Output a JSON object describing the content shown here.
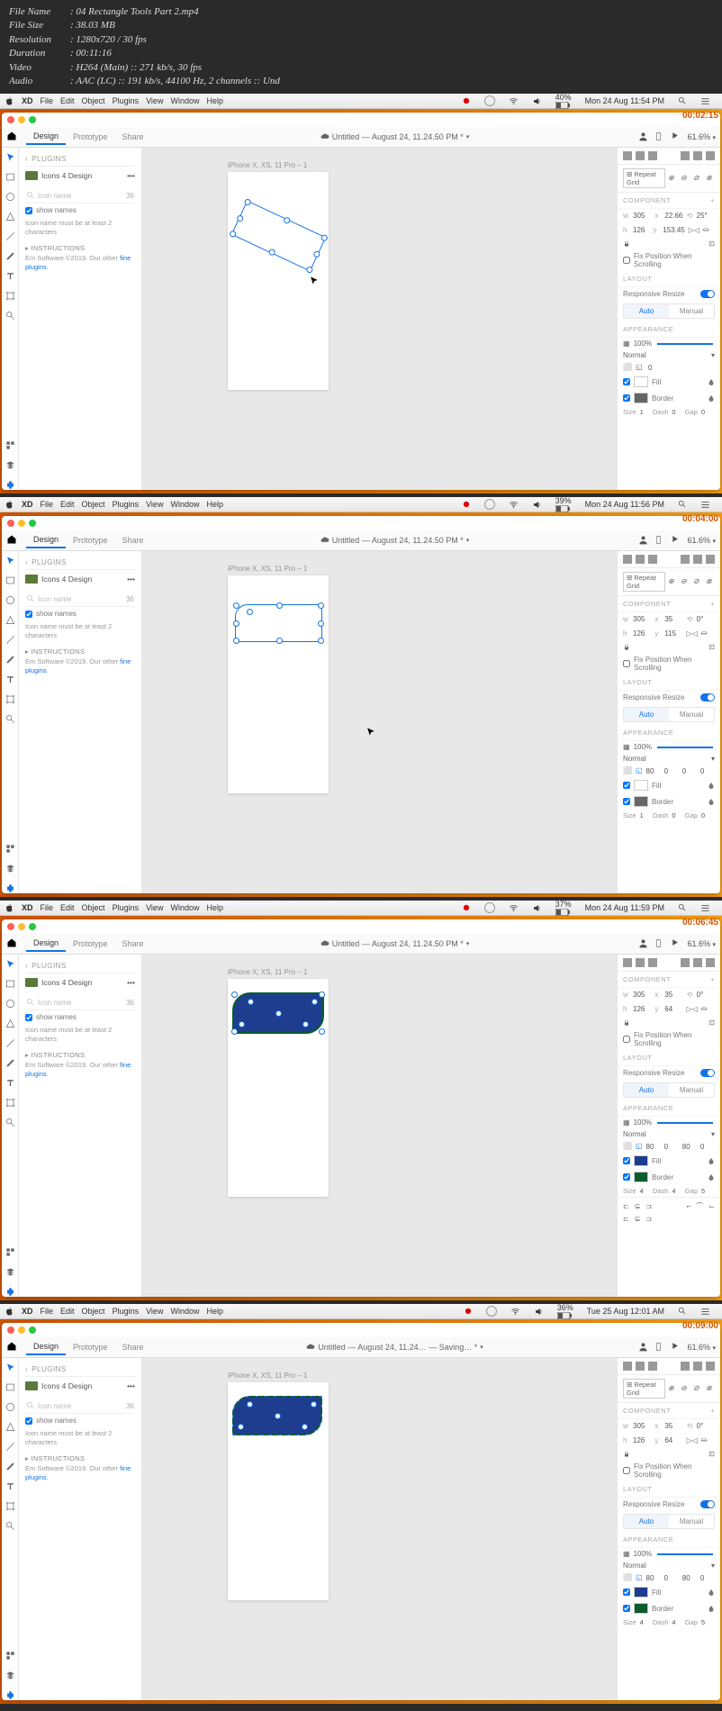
{
  "file_info": {
    "name": "04 Rectangle Tools Part 2.mp4",
    "size": "38.03 MB",
    "resolution": "1280x720 / 30 fps",
    "duration": "00:11:16",
    "video": "H264 (Main) :: 271 kb/s, 30 fps",
    "audio": "AAC (LC) :: 191 kb/s, 44100 Hz, 2 channels :: Und"
  },
  "menu": {
    "xd": "XD",
    "file": "File",
    "edit": "Edit",
    "object": "Object",
    "plugins": "Plugins",
    "view": "View",
    "window": "Window",
    "help": "Help"
  },
  "shots": [
    {
      "timestamp": "00:02:15",
      "menubar_time": "Mon 24 Aug 11:54 PM",
      "battery": "40%",
      "doc_title": "Untitled — August 24, 11.24.50 PM *",
      "zoom": "61.6%",
      "tabs": {
        "design": "Design",
        "prototype": "Prototype",
        "share": "Share"
      },
      "plugins_header": "PLUGINS",
      "plugin_name": "Icons 4 Design",
      "search_placeholder": "Icon name",
      "search_count": "36",
      "show_names": "show names",
      "note": "Icon name must be at least 2 characters",
      "instructions": "INSTRUCTIONS",
      "inst_text": "Em Software ©2019. Our other ",
      "inst_link": "fine plugins",
      "artboard": "iPhone X, XS, 11 Pro – 1",
      "props": {
        "w": "305",
        "x": "22.66",
        "rot": "25°",
        "h": "126",
        "y": "153.45",
        "flip": "⇌",
        "repeat": "Repeat Grid",
        "fix": "Fix Position When Scrolling",
        "layout": "LAYOUT",
        "resp": "Responsive Resize",
        "auto": "Auto",
        "manual": "Manual",
        "appear": "APPEARANCE",
        "opacity": "100%",
        "blend": "Normal",
        "corner": "0",
        "fill": "Fill",
        "border": "Border",
        "size": "Size",
        "size_v": "1",
        "dash": "Dash",
        "dash_v": "0",
        "gap": "Gap",
        "gap_v": "0",
        "component": "COMPONENT"
      }
    },
    {
      "timestamp": "00:04:00",
      "menubar_time": "Mon 24 Aug 11:56 PM",
      "battery": "39%",
      "doc_title": "Untitled — August 24, 11.24.50 PM *",
      "zoom": "61.6%",
      "tabs": {
        "design": "Design",
        "prototype": "Prototype",
        "share": "Share"
      },
      "plugins_header": "PLUGINS",
      "plugin_name": "Icons 4 Design",
      "search_placeholder": "Icon name",
      "search_count": "36",
      "show_names": "show names",
      "note": "Icon name must be at least 2 characters",
      "instructions": "INSTRUCTIONS",
      "inst_text": "Em Software ©2019. Our other ",
      "inst_link": "fine plugins",
      "artboard": "iPhone X, XS, 11 Pro – 1",
      "props": {
        "w": "305",
        "x": "35",
        "rot": "0°",
        "h": "126",
        "y": "115",
        "flip": "⇌",
        "repeat": "Repeat Grid",
        "fix": "Fix Position When Scrolling",
        "layout": "LAYOUT",
        "resp": "Responsive Resize",
        "auto": "Auto",
        "manual": "Manual",
        "appear": "APPEARANCE",
        "opacity": "100%",
        "blend": "Normal",
        "corner1": "80",
        "corner2": "0",
        "corner3": "0",
        "corner4": "0",
        "fill": "Fill",
        "border": "Border",
        "size": "Size",
        "size_v": "1",
        "dash": "Dash",
        "dash_v": "0",
        "gap": "Gap",
        "gap_v": "0",
        "component": "COMPONENT"
      }
    },
    {
      "timestamp": "00:06:45",
      "menubar_time": "Mon 24 Aug 11:59 PM",
      "battery": "37%",
      "doc_title": "Untitled — August 24, 11.24.50 PM *",
      "zoom": "61.6%",
      "tabs": {
        "design": "Design",
        "prototype": "Prototype",
        "share": "Share"
      },
      "plugins_header": "PLUGINS",
      "plugin_name": "Icons 4 Design",
      "search_placeholder": "Icon name",
      "search_count": "36",
      "show_names": "show names",
      "note": "Icon name must be at least 2 characters",
      "instructions": "INSTRUCTIONS",
      "inst_text": "Em Software ©2019. Our other ",
      "inst_link": "fine plugins",
      "artboard": "iPhone X, XS, 11 Pro – 1",
      "props": {
        "w": "305",
        "x": "35",
        "rot": "0°",
        "h": "126",
        "y": "64",
        "flip": "⇌",
        "fix": "Fix Position When Scrolling",
        "layout": "LAYOUT",
        "resp": "Responsive Resize",
        "auto": "Auto",
        "manual": "Manual",
        "appear": "APPEARANCE",
        "opacity": "100%",
        "blend": "Normal",
        "corner1": "80",
        "corner2": "0",
        "corner3": "80",
        "corner4": "0",
        "fill": "Fill",
        "border": "Border",
        "size": "Size",
        "size_v": "4",
        "dash": "Dash",
        "dash_v": "4",
        "gap": "Gap",
        "gap_v": "5",
        "component": "COMPONENT"
      }
    },
    {
      "timestamp": "00:09:00",
      "menubar_time": "Tue 25 Aug 12:01 AM",
      "battery": "36%",
      "doc_title": "Untitled — August 24, 11.24… — Saving… *",
      "zoom": "61.6%",
      "tabs": {
        "design": "Design",
        "prototype": "Prototype",
        "share": "Share"
      },
      "plugins_header": "PLUGINS",
      "plugin_name": "Icons 4 Design",
      "search_placeholder": "Icon name",
      "search_count": "36",
      "show_names": "show names",
      "note": "Icon name must be at least 2 characters",
      "instructions": "INSTRUCTIONS",
      "inst_text": "Em Software ©2019. Our other ",
      "inst_link": "fine plugins",
      "artboard": "iPhone X, XS, 11 Pro – 1",
      "props": {
        "w": "305",
        "x": "35",
        "rot": "0°",
        "h": "126",
        "y": "64",
        "flip": "⇌",
        "repeat": "Repeat Grid",
        "fix": "Fix Position When Scrolling",
        "layout": "LAYOUT",
        "resp": "Responsive Resize",
        "auto": "Auto",
        "manual": "Manual",
        "appear": "APPEARANCE",
        "opacity": "100%",
        "blend": "Normal",
        "corner1": "80",
        "corner2": "0",
        "corner3": "80",
        "corner4": "0",
        "fill": "Fill",
        "border": "Border",
        "size": "Size",
        "size_v": "4",
        "dash": "Dash",
        "dash_v": "4",
        "gap": "Gap",
        "gap_v": "5",
        "component": "COMPONENT"
      }
    }
  ]
}
